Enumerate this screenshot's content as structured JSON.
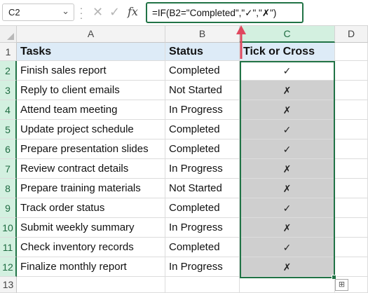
{
  "name_box": {
    "value": "C2"
  },
  "formula_bar": {
    "cancel_icon": "cross-icon",
    "enter_icon": "check-icon",
    "fx_label": "fx",
    "formula": "=IF(B2=\"Completed\",\"✓\",\"✗\")"
  },
  "columns": [
    "A",
    "B",
    "C",
    "D"
  ],
  "rows": [
    "1",
    "2",
    "3",
    "4",
    "5",
    "6",
    "7",
    "8",
    "9",
    "10",
    "11",
    "12",
    "13"
  ],
  "headers": {
    "a": "Tasks",
    "b": "Status",
    "c": "Tick or Cross"
  },
  "table": [
    {
      "task": "Finish sales report",
      "status": "Completed",
      "mark": "✓"
    },
    {
      "task": "Reply to client emails",
      "status": "Not Started",
      "mark": "✗"
    },
    {
      "task": "Attend team meeting",
      "status": "In Progress",
      "mark": "✗"
    },
    {
      "task": "Update project schedule",
      "status": "Completed",
      "mark": "✓"
    },
    {
      "task": "Prepare presentation slides",
      "status": "Completed",
      "mark": "✓"
    },
    {
      "task": "Review contract details",
      "status": "In Progress",
      "mark": "✗"
    },
    {
      "task": "Prepare training materials",
      "status": "Not Started",
      "mark": "✗"
    },
    {
      "task": "Track order status",
      "status": "Completed",
      "mark": "✓"
    },
    {
      "task": "Submit weekly summary",
      "status": "In Progress",
      "mark": "✗"
    },
    {
      "task": "Check inventory records",
      "status": "Completed",
      "mark": "✓"
    },
    {
      "task": "Finalize monthly report",
      "status": "In Progress",
      "mark": "✗"
    }
  ],
  "colors": {
    "header_fill": "#ddebf7",
    "result_fill": "#cfcfcf",
    "selection": "#217346",
    "arrow": "#e0475e"
  }
}
